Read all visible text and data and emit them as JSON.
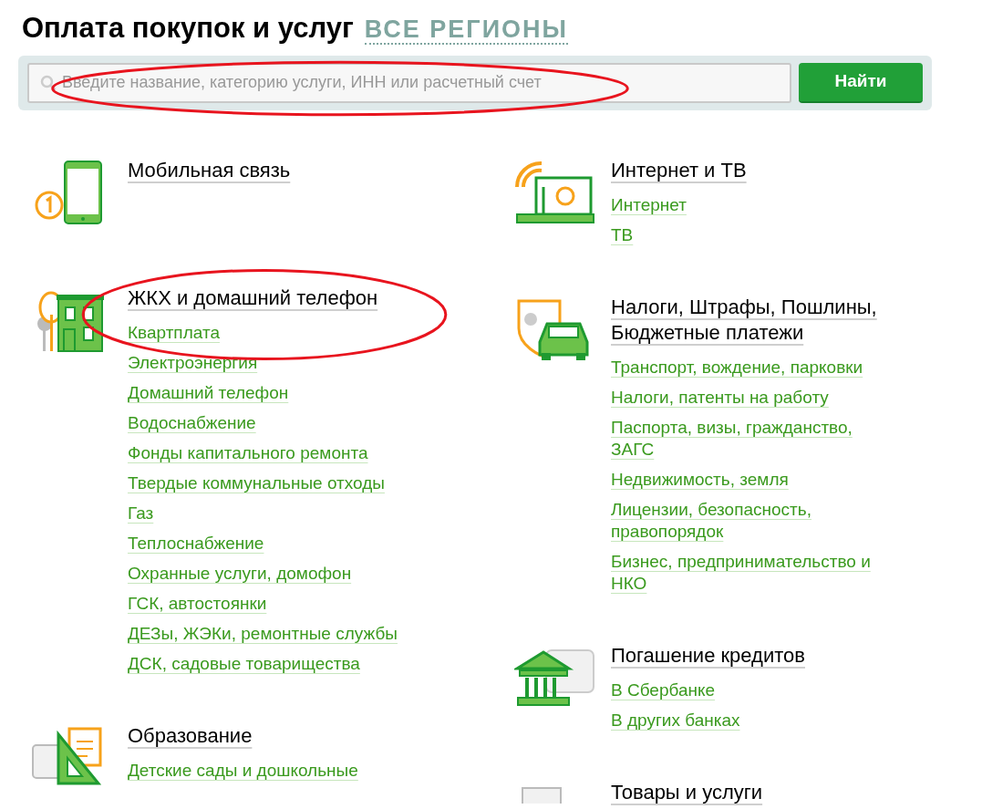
{
  "header": {
    "title": "Оплата покупок и услуг",
    "region_link": "ВСЕ РЕГИОНЫ"
  },
  "search": {
    "placeholder": "Введите название, категорию услуги, ИНН или расчетный счет",
    "button": "Найти",
    "circled": true
  },
  "columns": [
    {
      "sections": [
        {
          "kind": "phone",
          "title": "Мобильная связь",
          "circled": false
        },
        {
          "kind": "house",
          "title": "ЖКХ и домашний телефон",
          "circled": true,
          "links": [
            "Квартплата",
            "Электроэнергия",
            "Домашний телефон",
            "Водоснабжение",
            "Фонды капитального ремонта",
            "Твердые коммунальные отходы",
            "Газ",
            "Теплоснабжение",
            "Охранные услуги, домофон",
            "ГСК, автостоянки",
            "ДЕЗы, ЖЭКи, ремонтные службы",
            "ДСК, садовые товарищества"
          ]
        },
        {
          "kind": "education",
          "title": "Образование",
          "circled": false,
          "links": [
            "Детские сады и дошкольные"
          ]
        }
      ]
    },
    {
      "sections": [
        {
          "kind": "internet",
          "title": "Интернет и ТВ",
          "circled": false,
          "links": [
            "Интернет",
            "ТВ"
          ]
        },
        {
          "kind": "car",
          "title": "Налоги, Штрафы, Пошлины, Бюджетные платежи",
          "circled": false,
          "links": [
            "Транспорт, вождение, парковки",
            "Налоги, патенты на работу",
            "Паспорта, визы, гражданство, ЗАГС",
            "Недвижимость, земля",
            "Лицензии, безопасность, правопорядок",
            "Бизнес, предпринимательство и НКО"
          ]
        },
        {
          "kind": "bank",
          "title": "Погашение кредитов",
          "circled": false,
          "links": [
            "В Сбербанке",
            "В других банках"
          ]
        },
        {
          "kind": "goods",
          "title": "Товары и услуги",
          "circled": false
        }
      ]
    }
  ]
}
